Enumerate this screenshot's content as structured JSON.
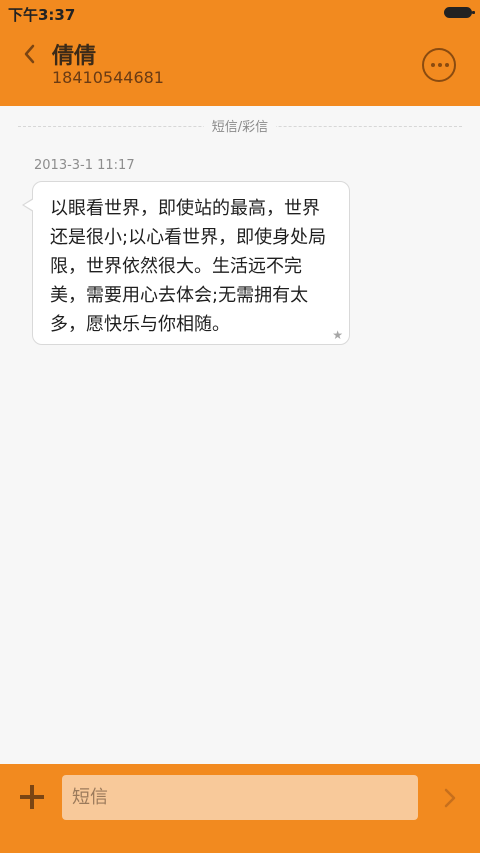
{
  "status_bar": {
    "time": "下午3:37"
  },
  "header": {
    "contact_name": "倩倩",
    "phone_number": "18410544681"
  },
  "conversation": {
    "channel_label": "短信/彩信",
    "messages": [
      {
        "timestamp": "2013-3-1 11:17",
        "text": "以眼看世界，即使站的最高，世界还是很小;以心看世界，即使身处局限，世界依然很大。生活远不完美，需要用心去体会;无需拥有太多，愿快乐与你相随。"
      }
    ]
  },
  "composer": {
    "placeholder": "短信"
  },
  "icons": {
    "back": "back-icon",
    "more": "more-icon",
    "add": "plus-icon",
    "send": "send-icon",
    "star": "star-icon"
  },
  "colors": {
    "accent": "#f28a1f",
    "input_bg": "#f8c99a"
  }
}
